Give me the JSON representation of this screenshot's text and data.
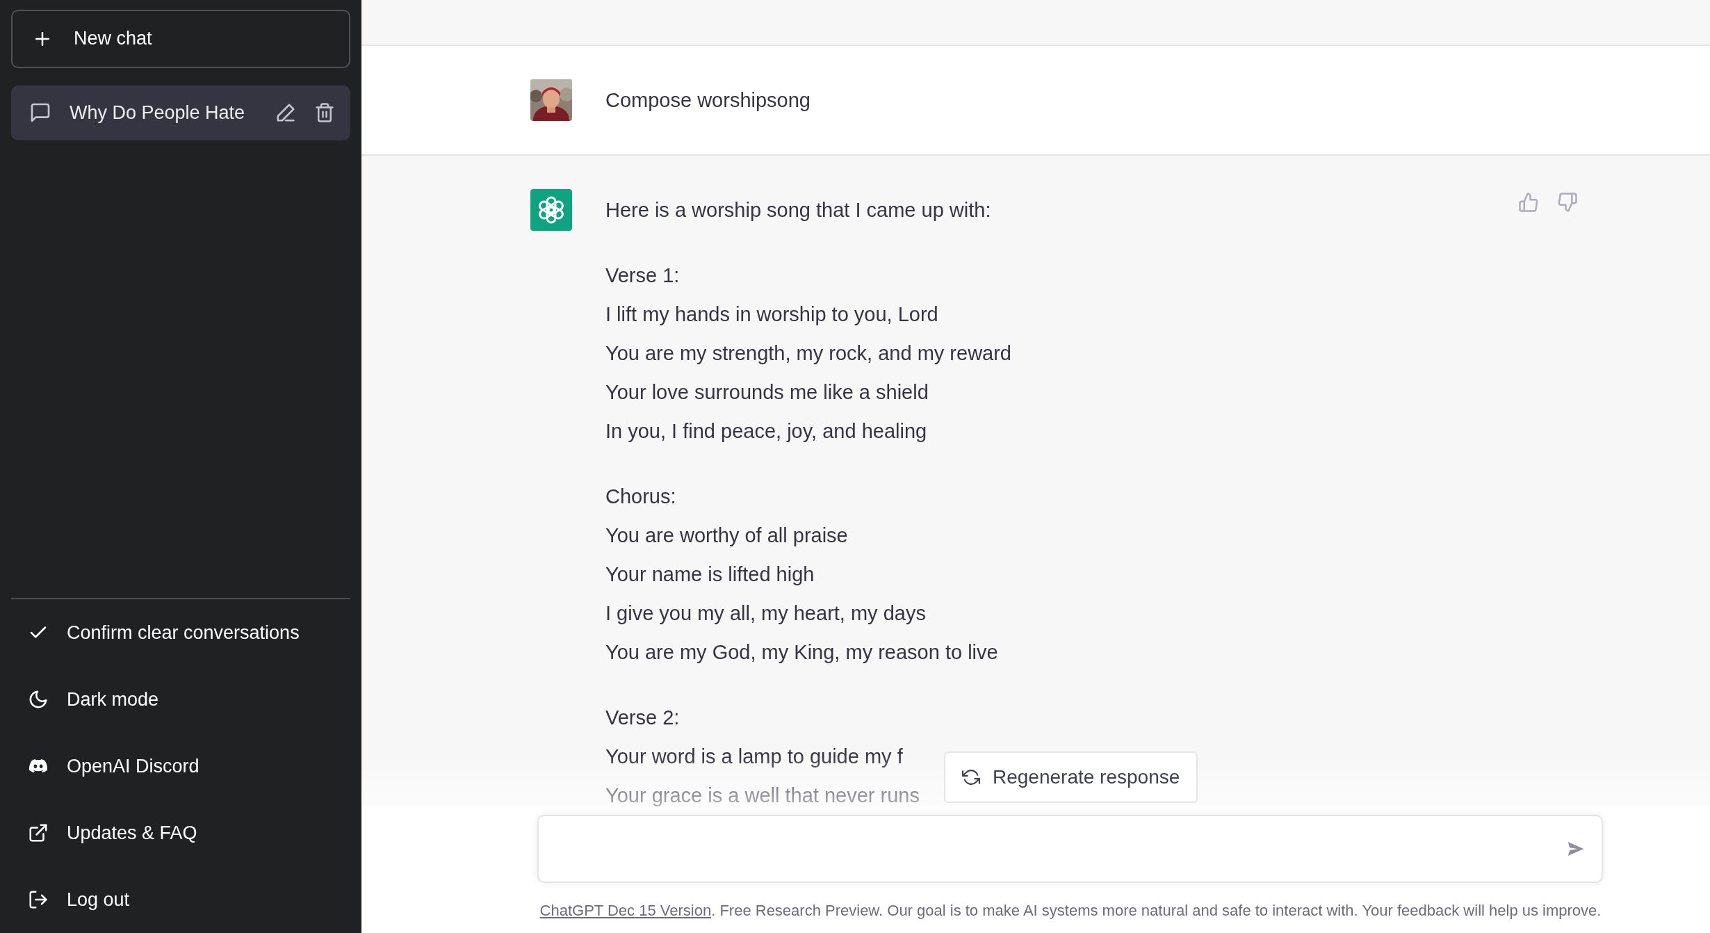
{
  "sidebar": {
    "new_chat": "New chat",
    "conversations": [
      {
        "title": "Why Do People Hate",
        "selected": true
      }
    ],
    "menu": [
      {
        "label": "Confirm clear conversations"
      },
      {
        "label": "Dark mode"
      },
      {
        "label": "OpenAI Discord"
      },
      {
        "label": "Updates & FAQ"
      },
      {
        "label": "Log out"
      }
    ]
  },
  "messages": [
    {
      "kind": "user",
      "text": "Compose worshipsong"
    },
    {
      "kind": "assistant",
      "paragraphs": [
        [
          "Here is a worship song that I came up with:"
        ],
        [
          "Verse 1:",
          "I lift my hands in worship to you, Lord",
          "You are my strength, my rock, and my reward",
          "Your love surrounds me like a shield",
          "In you, I find peace, joy, and healing"
        ],
        [
          "Chorus:",
          "You are worthy of all praise",
          "Your name is lifted high",
          "I give you my all, my heart, my days",
          "You are my God, my King, my reason to live"
        ],
        [
          "Verse 2:",
          "Your word is a lamp to guide my f",
          "Your grace is a well that never runs"
        ]
      ]
    }
  ],
  "regenerate_button": "Regenerate response",
  "footer": {
    "link": "ChatGPT Dec 15 Version",
    "text": ". Free Research Preview. Our goal is to make AI systems more natural and safe to interact with. Your feedback will help us improve."
  }
}
